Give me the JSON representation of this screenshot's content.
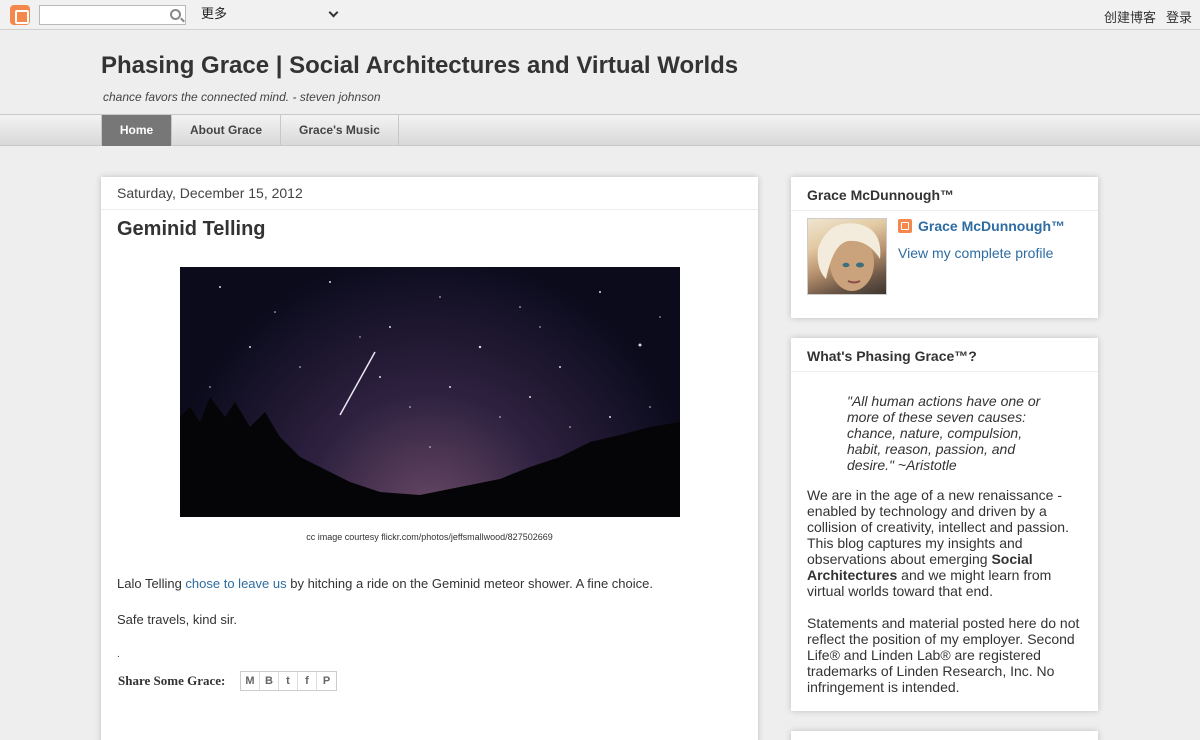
{
  "navbar": {
    "search_placeholder": "",
    "more_label": "更多",
    "create_blog": "创建博客",
    "login": "登录"
  },
  "header": {
    "title": "Phasing Grace | Social Architectures and Virtual Worlds",
    "description": "chance favors the connected mind. - steven johnson"
  },
  "tabs": [
    {
      "label": "Home"
    },
    {
      "label": "About Grace"
    },
    {
      "label": "Grace's Music"
    }
  ],
  "post": {
    "date": "Saturday, December 15, 2012",
    "title": "Geminid Telling",
    "caption": "cc image courtesy flickr.com/photos/jeffsmallwood/827502669",
    "p1_before": "Lalo Telling ",
    "p1_link": "chose to leave us",
    "p1_after": " by hitching a ride on the Geminid meteor shower. A fine choice.",
    "p2": "Safe travels, kind sir.",
    "p3": ".",
    "share_label": "Share Some Grace:"
  },
  "sidebar": {
    "profile": {
      "title": "Grace McDunnough™",
      "name": "Grace McDunnough™",
      "link": "View my complete profile"
    },
    "about": {
      "title": "What's Phasing Grace™?",
      "quote": "\"All human actions have one or more of these seven causes: chance, nature, compulsion, habit, reason, passion, and desire.\" ~Aristotle",
      "p1_a": "We are in the age of a new renaissance - enabled by technology and driven by a collision of creativity, intellect and passion. This blog captures my insights and observations about emerging ",
      "p1_bold": "Social Architectures",
      "p1_b": " and we might learn from virtual worlds toward that end.",
      "p2": "Statements and material posted here do not reflect the position of my employer. Second Life® and Linden Lab® are registered trademarks of Linden Research, Inc. No infringement is intended."
    }
  },
  "colors": {
    "link": "#2d6ca2",
    "blogger_orange": "#f4874b",
    "active_tab": "#777777"
  }
}
